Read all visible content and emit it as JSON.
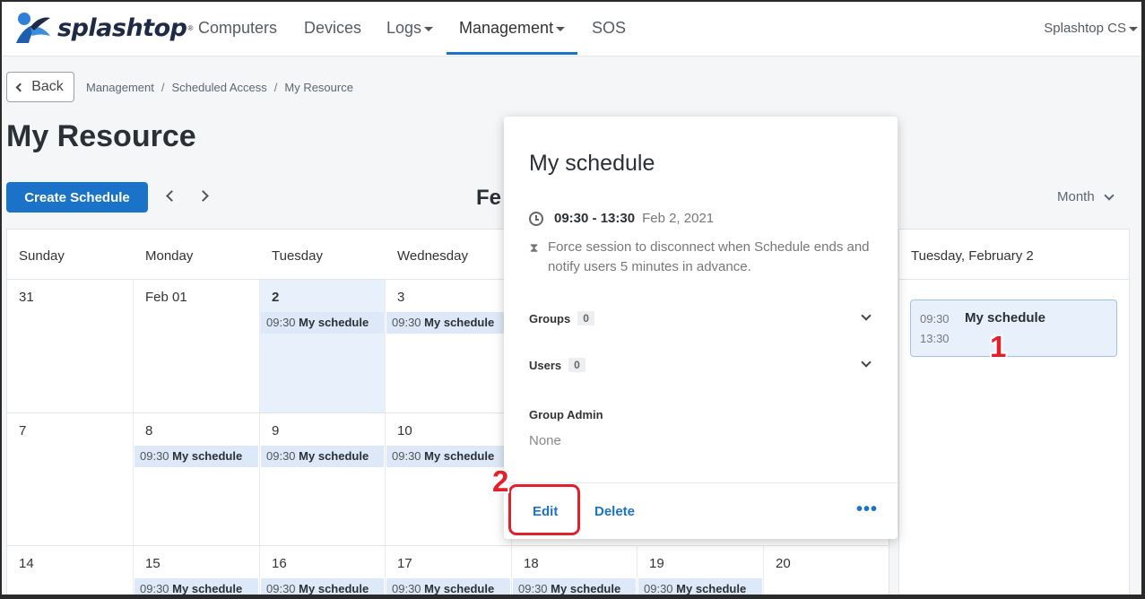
{
  "brand": {
    "name": "splashtop",
    "reg": "®"
  },
  "nav": {
    "items": [
      {
        "label": "Computers",
        "dropdown": false,
        "active": false
      },
      {
        "label": "Devices",
        "dropdown": false,
        "active": false
      },
      {
        "label": "Logs",
        "dropdown": true,
        "active": false
      },
      {
        "label": "Management",
        "dropdown": true,
        "active": true
      },
      {
        "label": "SOS",
        "dropdown": false,
        "active": false
      }
    ],
    "account": "Splashtop CS"
  },
  "back_label": "Back",
  "breadcrumb": [
    "Management",
    "Scheduled Access",
    "My Resource"
  ],
  "page_title": "My Resource",
  "toolbar": {
    "create_label": "Create Schedule",
    "month_title": "Fe",
    "view_label": "Month"
  },
  "calendar": {
    "days": [
      "Sunday",
      "Monday",
      "Tuesday",
      "Wednesday"
    ],
    "weeks": [
      [
        {
          "date": "31",
          "event": null
        },
        {
          "date": "Feb 01",
          "event": null
        },
        {
          "date": "2",
          "event": {
            "time": "09:30",
            "title": "My schedule"
          },
          "today": true
        },
        {
          "date": "3",
          "event": {
            "time": "09:30",
            "title": "My schedule"
          }
        }
      ],
      [
        {
          "date": "7",
          "event": null
        },
        {
          "date": "8",
          "event": {
            "time": "09:30",
            "title": "My schedule"
          }
        },
        {
          "date": "9",
          "event": {
            "time": "09:30",
            "title": "My schedule"
          }
        },
        {
          "date": "10",
          "event": {
            "time": "09:30",
            "title": "My schedule"
          }
        }
      ],
      [
        {
          "date": "14",
          "event": null
        },
        {
          "date": "15",
          "event": {
            "time": "09:30",
            "title": "My schedule"
          }
        },
        {
          "date": "16",
          "event": {
            "time": "09:30",
            "title": "My schedule"
          }
        },
        {
          "date": "17",
          "event": {
            "time": "09:30",
            "title": "My schedule"
          }
        },
        {
          "date": "18",
          "event": {
            "time": "09:30",
            "title": "My schedule"
          }
        },
        {
          "date": "19",
          "event": {
            "time": "09:30",
            "title": "My schedule"
          }
        },
        {
          "date": "20",
          "event": null
        }
      ]
    ]
  },
  "day_panel": {
    "header": "Tuesday, February 2",
    "event": {
      "start": "09:30",
      "end": "13:30",
      "title": "My schedule"
    }
  },
  "popover": {
    "title": "My schedule",
    "time_range": "09:30 - 13:30",
    "date": "Feb 2, 2021",
    "note": "Force session to disconnect when Schedule ends and notify users 5 minutes in advance.",
    "groups_label": "Groups",
    "groups_count": "0",
    "users_label": "Users",
    "users_count": "0",
    "group_admin_label": "Group Admin",
    "group_admin_value": "None",
    "edit_label": "Edit",
    "delete_label": "Delete",
    "more_label": "•••"
  },
  "annotations": {
    "step1": "1",
    "step2": "2",
    "color": "#e3202a"
  },
  "colors": {
    "accent": "#1a73c8",
    "event_bg": "#dde9f8",
    "today_bg": "#e8f1fb"
  }
}
